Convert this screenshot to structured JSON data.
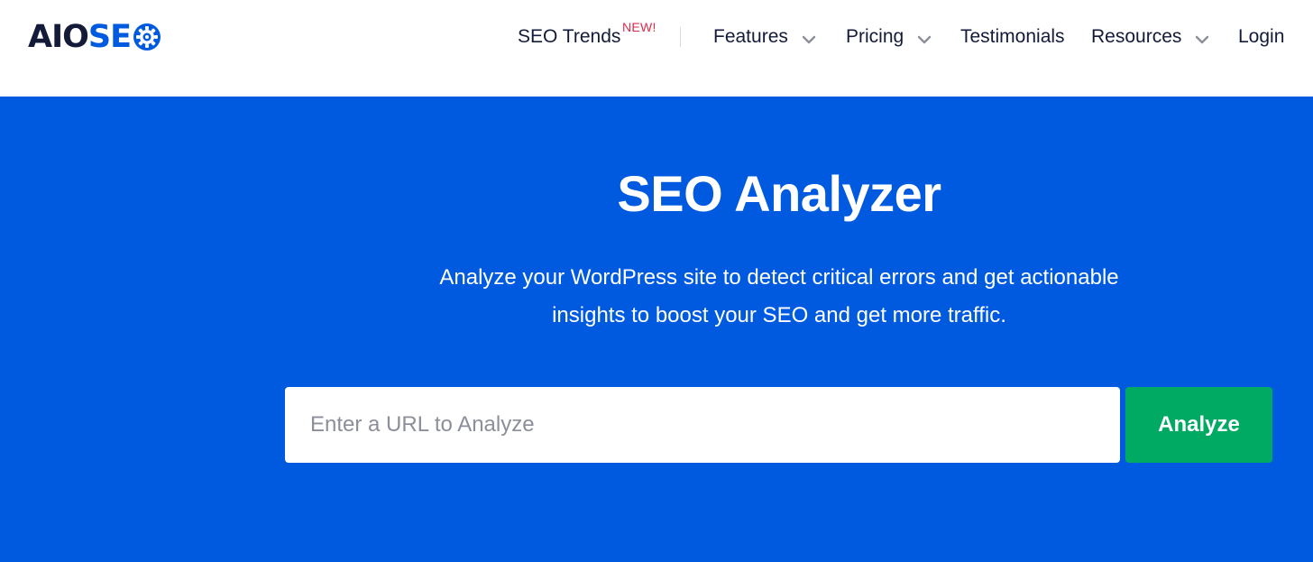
{
  "brand": {
    "logo_part1": "AIO",
    "logo_part2": "SE",
    "dark_color": "#141b38",
    "blue_color": "#005ae0"
  },
  "nav": {
    "seo_trends": "SEO Trends",
    "new_badge": "NEW!",
    "features": "Features",
    "pricing": "Pricing",
    "testimonials": "Testimonials",
    "resources": "Resources",
    "login": "Login"
  },
  "hero": {
    "title": "SEO Analyzer",
    "subtitle_line1": "Analyze your WordPress site to detect critical errors and get actionable",
    "subtitle_line2": "insights to boost your SEO and get more traffic.",
    "background": "#005ae0"
  },
  "search": {
    "placeholder": "Enter a URL to Analyze",
    "value": "",
    "button_label": "Analyze",
    "button_color": "#00aa63"
  }
}
